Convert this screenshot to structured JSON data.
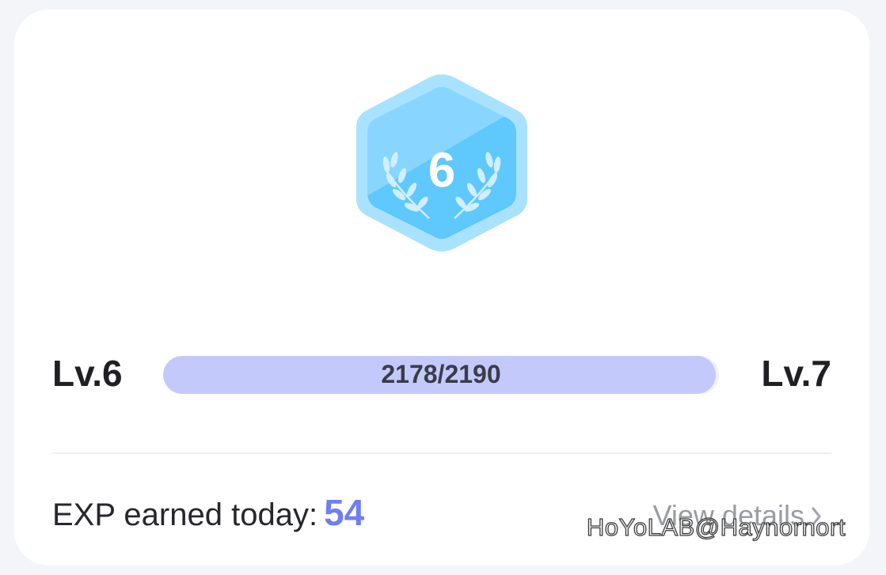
{
  "badge": {
    "level": "6",
    "icon": "hexagon-level-badge-with-laurels",
    "colors": {
      "outer": "#a9e2ff",
      "inner": "#5fc8fd",
      "highlight": "#8fd8ff"
    }
  },
  "progress": {
    "current_level": "Lv.6",
    "next_level": "Lv.7",
    "text": "2178/2190",
    "current": 2178,
    "total": 2190,
    "fraction": 0.9945,
    "fill_color": "#c3cafb"
  },
  "exp": {
    "label": "EXP earned today:",
    "value": "54",
    "value_color": "#6f7fef"
  },
  "details": {
    "label": "View details",
    "icon": "chevron-right-icon"
  },
  "watermark": {
    "text": "HoYoLAB@Haynornort"
  }
}
